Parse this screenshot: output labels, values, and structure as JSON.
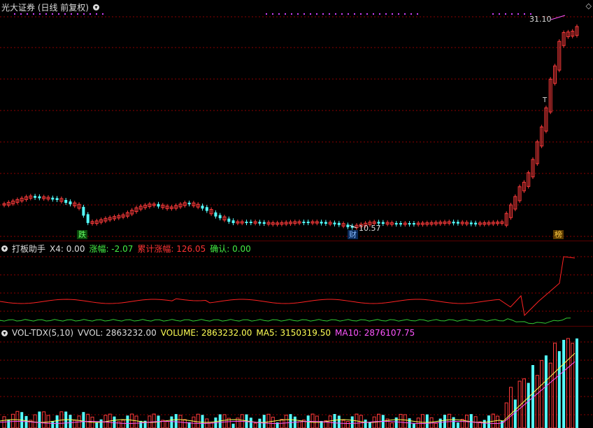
{
  "main": {
    "title": "光大证券 (日线 前复权)",
    "high_label": "31.10",
    "low_label": "10.57",
    "t_marker": "T",
    "badges": [
      {
        "text": "跌",
        "color": "#44dd44"
      },
      {
        "text": "财",
        "color": "#5599ff"
      },
      {
        "text": "榜",
        "color": "#e0a000"
      }
    ],
    "diamond": "◇",
    "chevron": "▾"
  },
  "indicator": {
    "name": "打板助手",
    "x4": "X4: 0.00",
    "zhangfu": "涨幅: -2.07",
    "leiji": "累计涨幅: 126.05",
    "queren": "确认: 0.00"
  },
  "volume": {
    "name": "VOL-TDX(5,10)",
    "vvol": "VVOL: 2863232.00",
    "volume": "VOLUME: 2863232.00",
    "ma5": "MA5: 3150319.50",
    "ma10": "MA10: 2876107.75"
  },
  "colors": {
    "up": "#ff3b3b",
    "down": "#54ffff",
    "grid": "#8b0000",
    "ma5": "#ffff55",
    "ma10": "#ff55ff",
    "ind_red": "#ff2222",
    "ind_green": "#33cc33"
  }
}
